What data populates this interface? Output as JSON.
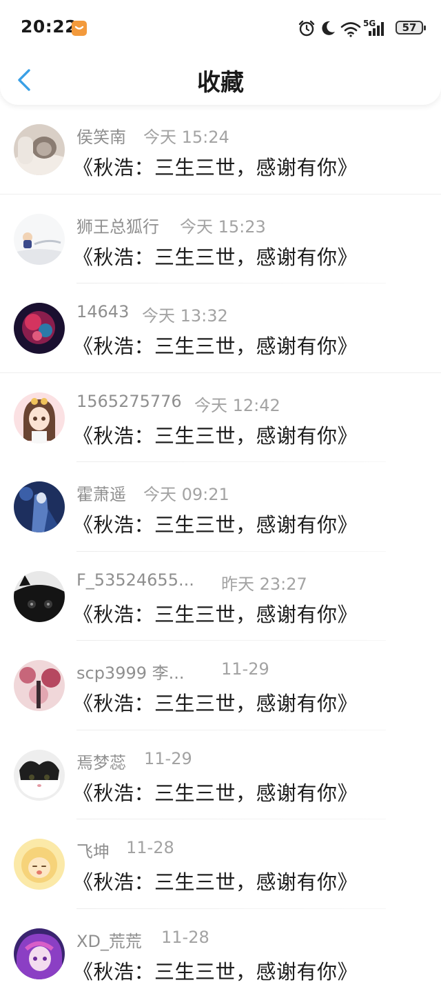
{
  "status_bar": {
    "time": "20:22",
    "network": "5G",
    "battery": "57"
  },
  "header": {
    "title": "收藏",
    "back_icon": "chevron-left-icon"
  },
  "favorites": [
    {
      "name": "侯笑南",
      "time": "今天 15:24",
      "title": "《秋浩：三生三世，感谢有你》"
    },
    {
      "name": "狮王总狐行",
      "time": "今天 15:23",
      "title": "《秋浩：三生三世，感谢有你》"
    },
    {
      "name": "14643",
      "time": "今天 13:32",
      "title": "《秋浩：三生三世，感谢有你》"
    },
    {
      "name": "1565275776",
      "time": "今天 12:42",
      "title": "《秋浩：三生三世，感谢有你》"
    },
    {
      "name": "霍萧遥",
      "time": "今天 09:21",
      "title": "《秋浩：三生三世，感谢有你》"
    },
    {
      "name": "F_53524655...",
      "time": "昨天 23:27",
      "title": "《秋浩：三生三世，感谢有你》"
    },
    {
      "name": "scp3999 李...",
      "time": "11-29",
      "title": "《秋浩：三生三世，感谢有你》"
    },
    {
      "name": "焉梦蕊",
      "time": "11-29",
      "title": "《秋浩：三生三世，感谢有你》"
    },
    {
      "name": "飞坤",
      "time": "11-28",
      "title": "《秋浩：三生三世，感谢有你》"
    },
    {
      "name": "XD_荒荒",
      "time": "11-28",
      "title": "《秋浩：三生三世，感谢有你》"
    }
  ],
  "colors": {
    "accent": "#3aa0e6",
    "name_text": "#8f8f8f",
    "time_text": "#a3a3a3",
    "title_text": "#1d1d1d"
  }
}
